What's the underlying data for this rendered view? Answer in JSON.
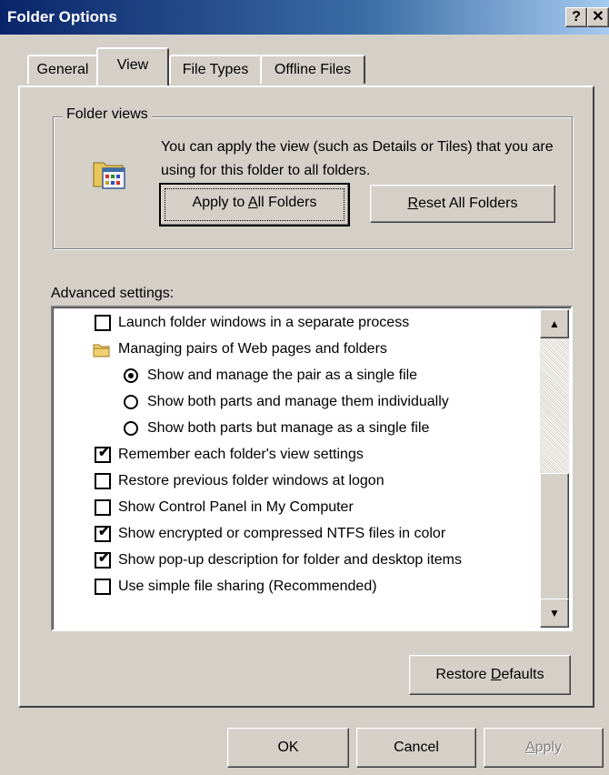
{
  "window": {
    "title": "Folder Options",
    "help_button": "?",
    "close_button": "✕"
  },
  "tabs": [
    {
      "label": "General"
    },
    {
      "label": "View"
    },
    {
      "label": "File Types"
    },
    {
      "label": "Offline Files"
    }
  ],
  "active_tab": "View",
  "folder_views": {
    "label": "Folder views",
    "description": "You can apply the view (such as Details or Tiles) that you are using for this folder to all folders.",
    "apply_pre": "Apply to ",
    "apply_key": "A",
    "apply_post": "ll Folders",
    "reset_key": "R",
    "reset_post": "eset All Folders"
  },
  "advanced": {
    "label": "Advanced settings:",
    "items": [
      {
        "type": "checkbox",
        "checked": false,
        "label": "Launch folder windows in a separate process"
      },
      {
        "type": "folder",
        "label": "Managing pairs of Web pages and folders"
      },
      {
        "type": "radio",
        "selected": true,
        "label": "Show and manage the pair as a single file"
      },
      {
        "type": "radio",
        "selected": false,
        "label": "Show both parts and manage them individually"
      },
      {
        "type": "radio",
        "selected": false,
        "label": "Show both parts but manage as a single file"
      },
      {
        "type": "checkbox",
        "checked": true,
        "label": "Remember each folder's view settings"
      },
      {
        "type": "checkbox",
        "checked": false,
        "label": "Restore previous folder windows at logon"
      },
      {
        "type": "checkbox",
        "checked": false,
        "label": "Show Control Panel in My Computer"
      },
      {
        "type": "checkbox",
        "checked": true,
        "label": "Show encrypted or compressed NTFS files in color"
      },
      {
        "type": "checkbox",
        "checked": true,
        "label": "Show pop-up description for folder and desktop items"
      },
      {
        "type": "checkbox",
        "checked": false,
        "label": "Use simple file sharing (Recommended)"
      }
    ],
    "restore_pre": "Restore ",
    "restore_key": "D",
    "restore_post": "efaults"
  },
  "footer": {
    "ok_label": "OK",
    "cancel_label": "Cancel",
    "apply_key": "A",
    "apply_post": "pply"
  },
  "icons": {
    "check": "✔",
    "scroll_up": "▲",
    "scroll_down": "▼"
  }
}
